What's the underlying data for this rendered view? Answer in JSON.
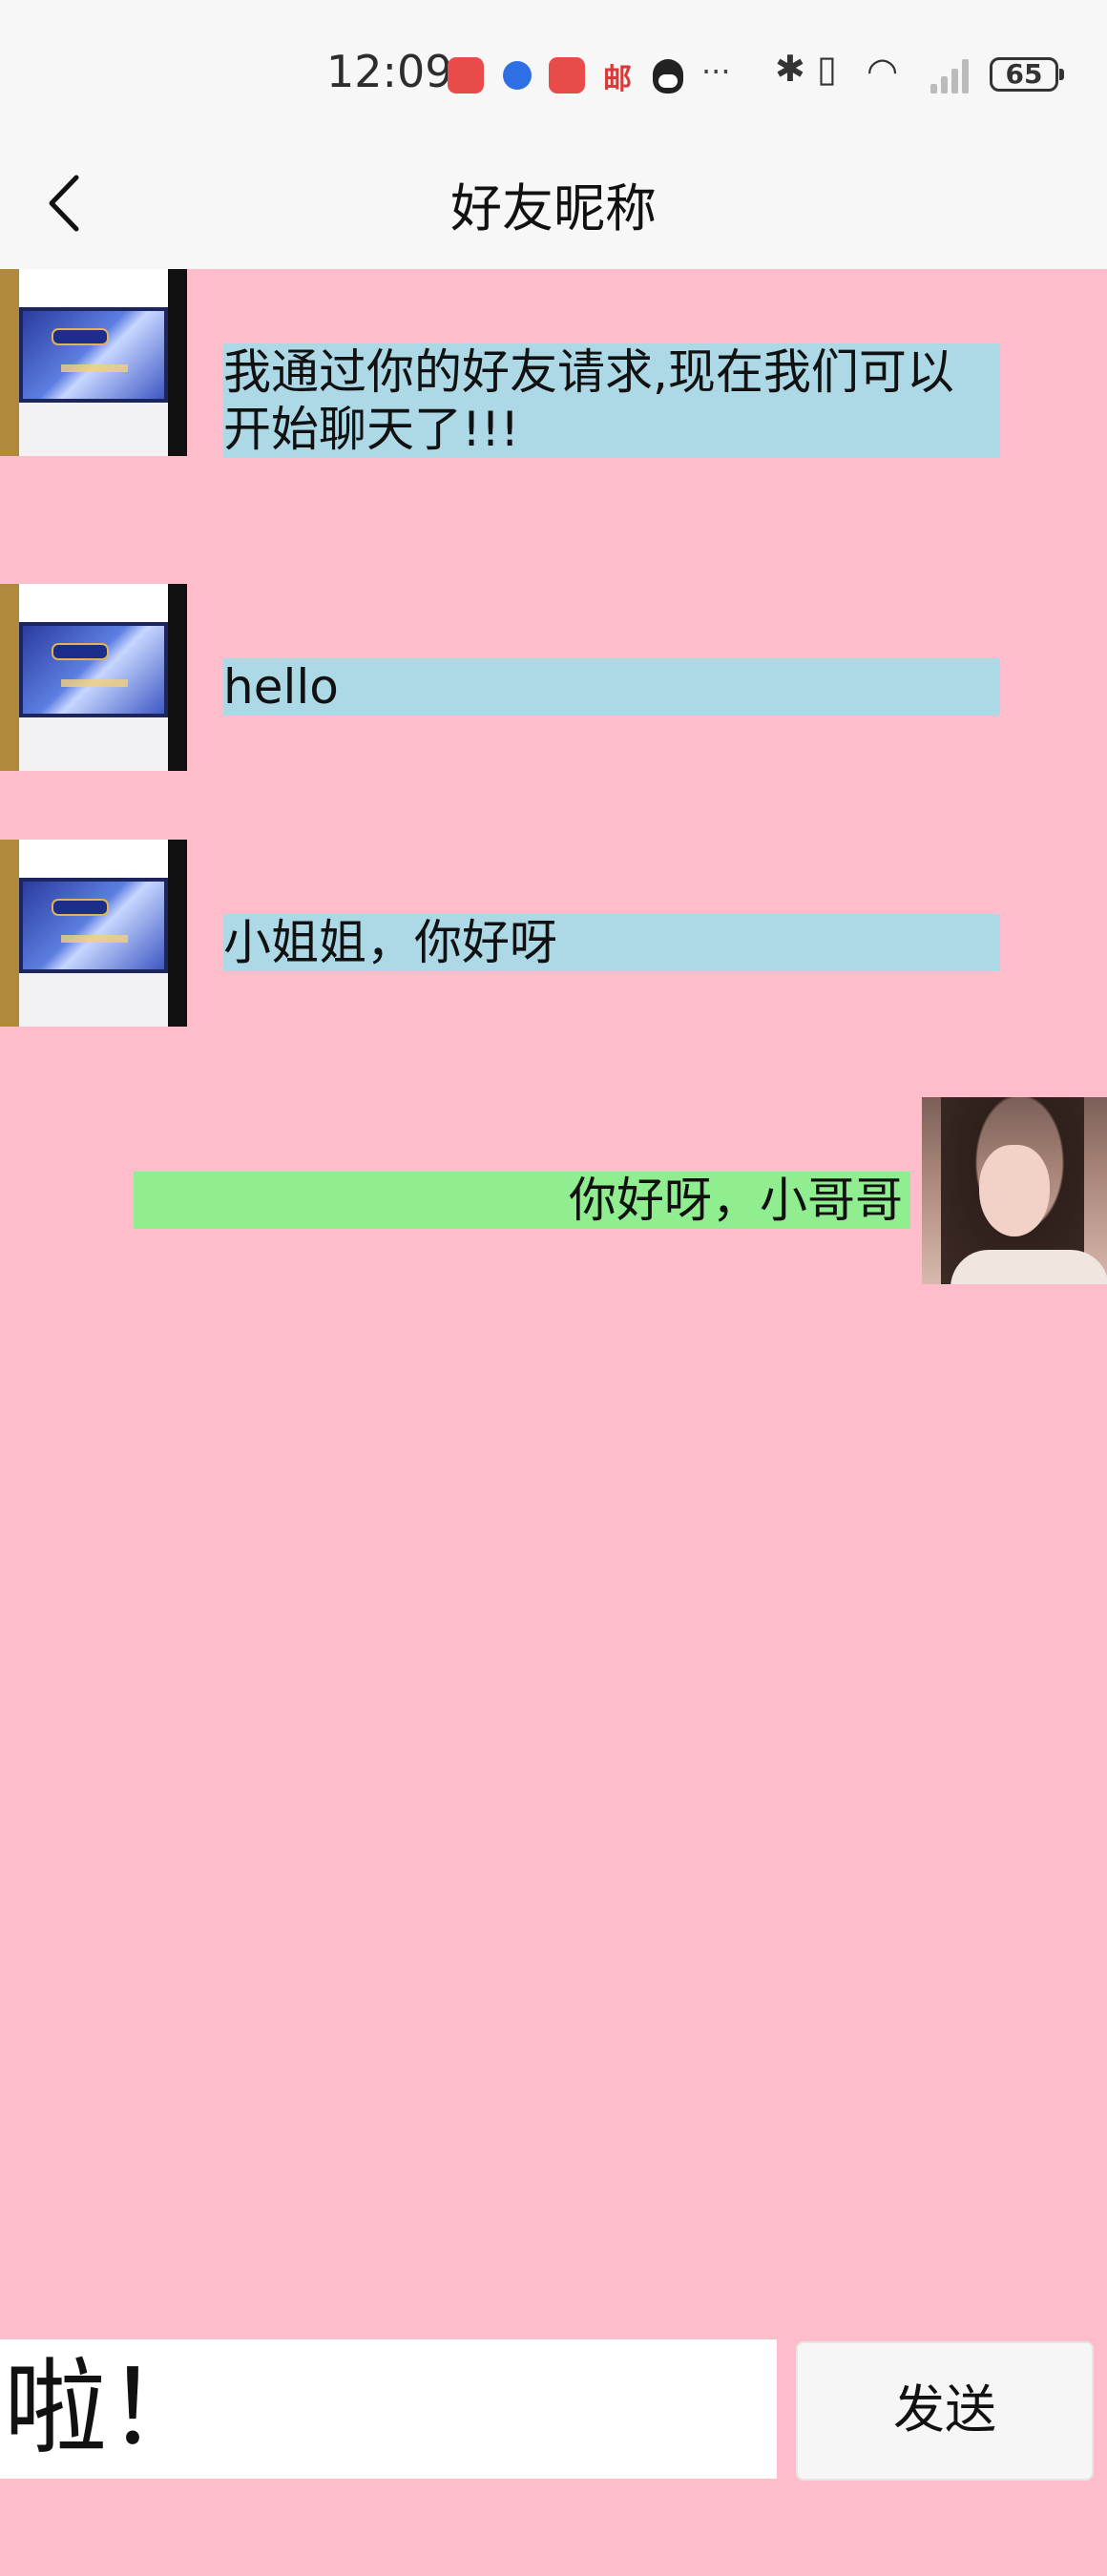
{
  "status_bar": {
    "time": "12:09",
    "notification_icons": [
      "huawei-appgallery-icon",
      "baidu-icon",
      "huawei-appgallery-icon",
      "mail-icon",
      "qq-icon",
      "more-icon"
    ],
    "mail_glyph": "邮",
    "more_glyph": "···",
    "system_icons": [
      "bluetooth-icon",
      "vibrate-icon",
      "wifi-icon",
      "signal-icon",
      "battery-icon"
    ],
    "bluetooth_glyph": "✱",
    "vibrate_glyph": "▯",
    "wifi_glyph": "◠",
    "battery": "65"
  },
  "header": {
    "title": "好友昵称",
    "back_icon": "chevron-left-icon"
  },
  "messages": [
    {
      "direction": "received",
      "avatar": "certificate-avatar",
      "text": "我通过你的好友请求,现在我们可以开始聊天了!!!"
    },
    {
      "direction": "received",
      "avatar": "certificate-avatar",
      "text": "hello"
    },
    {
      "direction": "received",
      "avatar": "certificate-avatar",
      "text": "小姐姐，你好呀"
    },
    {
      "direction": "sent",
      "avatar": "girl-portrait-avatar",
      "text": "你好呀，小哥哥"
    }
  ],
  "composer": {
    "input_value": "啦！",
    "send_label": "发送"
  },
  "colors": {
    "background": "#ffbccb",
    "received_bubble": "#add8e6",
    "sent_bubble": "#90ee90",
    "bars": "#f7f7f7"
  }
}
